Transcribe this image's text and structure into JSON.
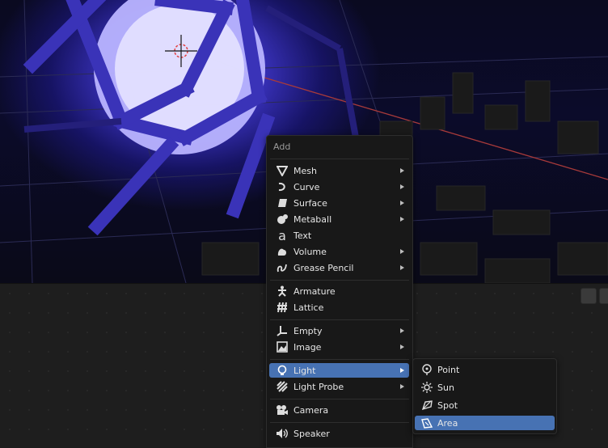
{
  "menu": {
    "title": "Add",
    "items": [
      {
        "label": "Mesh",
        "icon": "mesh-icon",
        "submenu": true
      },
      {
        "label": "Curve",
        "icon": "curve-icon",
        "submenu": true
      },
      {
        "label": "Surface",
        "icon": "surface-icon",
        "submenu": true
      },
      {
        "label": "Metaball",
        "icon": "metaball-icon",
        "submenu": true
      },
      {
        "label": "Text",
        "icon": "text-icon",
        "submenu": false
      },
      {
        "label": "Volume",
        "icon": "volume-icon",
        "submenu": true
      },
      {
        "label": "Grease Pencil",
        "icon": "grease-pencil-icon",
        "submenu": true
      },
      {
        "label": "Armature",
        "icon": "armature-icon",
        "submenu": false
      },
      {
        "label": "Lattice",
        "icon": "lattice-icon",
        "submenu": false
      },
      {
        "label": "Empty",
        "icon": "empty-icon",
        "submenu": true
      },
      {
        "label": "Image",
        "icon": "image-icon",
        "submenu": true
      },
      {
        "label": "Light",
        "icon": "light-icon",
        "submenu": true,
        "active": true
      },
      {
        "label": "Light Probe",
        "icon": "light-probe-icon",
        "submenu": true
      },
      {
        "label": "Camera",
        "icon": "camera-icon",
        "submenu": false
      },
      {
        "label": "Speaker",
        "icon": "speaker-icon",
        "submenu": false
      }
    ]
  },
  "light_submenu": {
    "items": [
      {
        "label": "Point",
        "icon": "point-light-icon"
      },
      {
        "label": "Sun",
        "icon": "sun-light-icon"
      },
      {
        "label": "Spot",
        "icon": "spot-light-icon"
      },
      {
        "label": "Area",
        "icon": "area-light-icon",
        "active": true
      }
    ]
  },
  "colors": {
    "menu_bg": "#181818",
    "highlight": "#4772b3",
    "viewport_glow": "#6e64ff"
  }
}
